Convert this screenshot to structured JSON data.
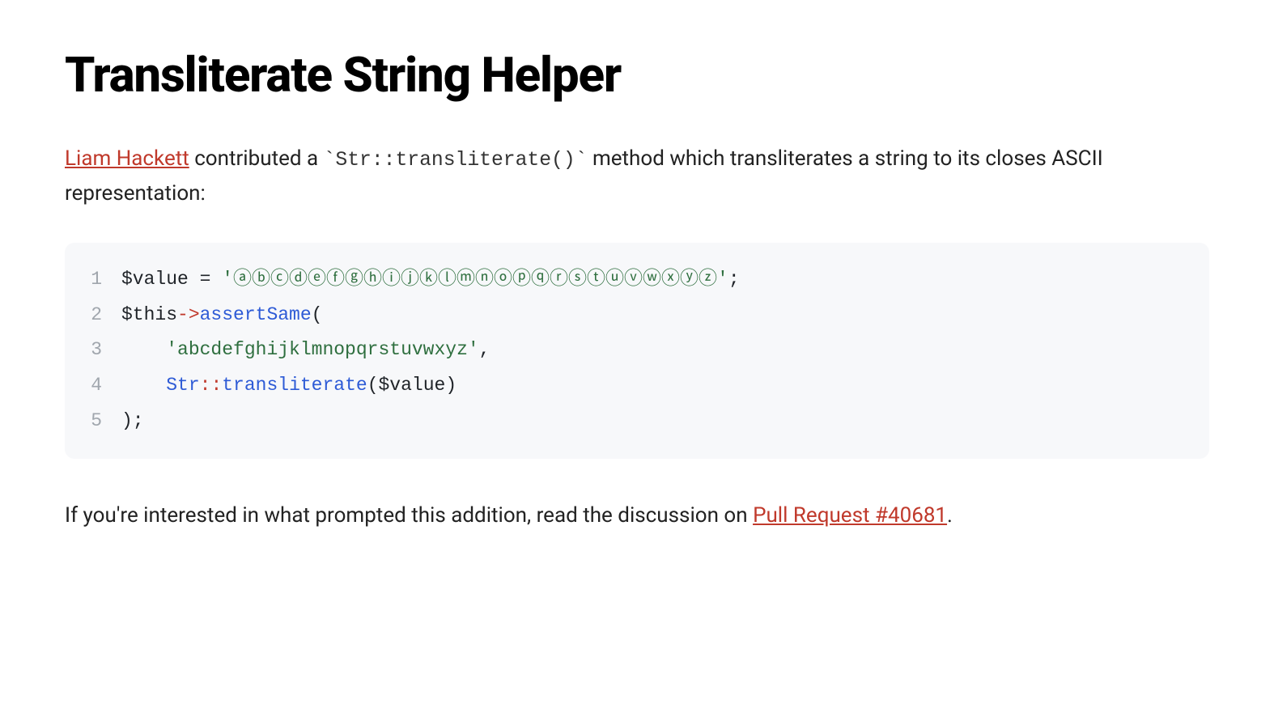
{
  "heading": "Transliterate String Helper",
  "intro": {
    "author_link": "Liam Hackett",
    "text_after_author": " contributed a ",
    "inline_code": "`Str::transliterate()`",
    "text_after_code": " method which transliterates a string to its closes ASCII representation:"
  },
  "code": {
    "lines": [
      {
        "num": "1",
        "segments": [
          {
            "cls": "tok-var",
            "text": "$value"
          },
          {
            "cls": "tok-op",
            "text": " = "
          },
          {
            "cls": "tok-str",
            "text": "'ⓐⓑⓒⓓⓔⓕⓖⓗⓘⓙⓚⓛⓜⓝⓞⓟⓠⓡⓢⓣⓤⓥⓦⓧⓨⓩ'"
          },
          {
            "cls": "tok-punc",
            "text": ";"
          }
        ]
      },
      {
        "num": "2",
        "segments": [
          {
            "cls": "tok-var",
            "text": "$this"
          },
          {
            "cls": "tok-arrow",
            "text": "->"
          },
          {
            "cls": "tok-fn",
            "text": "assertSame"
          },
          {
            "cls": "tok-punc",
            "text": "("
          }
        ]
      },
      {
        "num": "3",
        "segments": [
          {
            "cls": "tok-punc",
            "text": "    "
          },
          {
            "cls": "tok-str",
            "text": "'abcdefghijklmnopqrstuvwxyz'"
          },
          {
            "cls": "tok-punc",
            "text": ","
          }
        ]
      },
      {
        "num": "4",
        "segments": [
          {
            "cls": "tok-punc",
            "text": "    "
          },
          {
            "cls": "tok-class",
            "text": "Str"
          },
          {
            "cls": "tok-dcolon",
            "text": "::"
          },
          {
            "cls": "tok-fn",
            "text": "transliterate"
          },
          {
            "cls": "tok-punc",
            "text": "("
          },
          {
            "cls": "tok-var",
            "text": "$value"
          },
          {
            "cls": "tok-punc",
            "text": ")"
          }
        ]
      },
      {
        "num": "5",
        "segments": [
          {
            "cls": "tok-punc",
            "text": ");"
          }
        ]
      }
    ]
  },
  "outro": {
    "text_before_link": "If you're interested in what prompted this addition, read the discussion on ",
    "pr_link": "Pull Request #40681",
    "text_after_link": "."
  }
}
